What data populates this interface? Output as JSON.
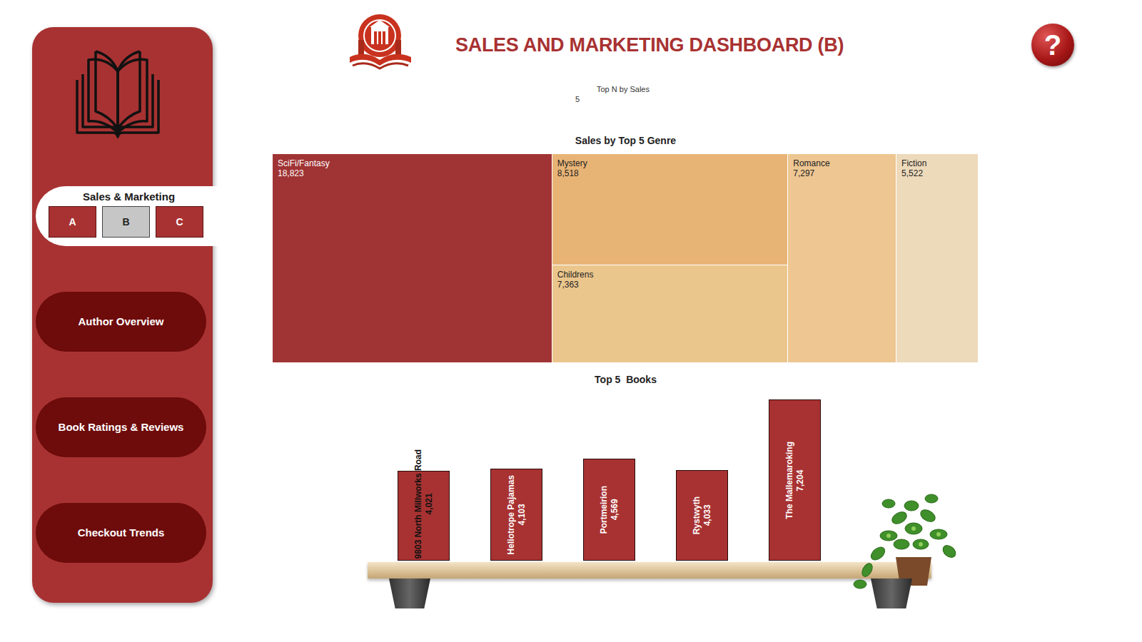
{
  "header": {
    "title": "SALES AND MARKETING DASHBOARD (B)",
    "help": "?"
  },
  "sidebar": {
    "section": "Sales & Marketing",
    "pages": [
      {
        "label": "A",
        "selected": false
      },
      {
        "label": "B",
        "selected": true
      },
      {
        "label": "C",
        "selected": false
      }
    ],
    "nav": [
      {
        "label": "Author Overview"
      },
      {
        "label": "Book Ratings & Reviews"
      },
      {
        "label": "Checkout Trends"
      }
    ]
  },
  "filter": {
    "label": "Top N by Sales",
    "value": "5"
  },
  "genre_chart": {
    "title": "Sales by Top 5 Genre",
    "items": [
      {
        "label": "SciFi/Fantasy",
        "value_text": "18,823",
        "value": 18823,
        "color": "#a03434"
      },
      {
        "label": "Mystery",
        "value_text": "8,518",
        "value": 8518,
        "color": "#e8b476"
      },
      {
        "label": "Childrens",
        "value_text": "7,363",
        "value": 7363,
        "color": "#ebc68c"
      },
      {
        "label": "Romance",
        "value_text": "7,297",
        "value": 7297,
        "color": "#edc692"
      },
      {
        "label": "Fiction",
        "value_text": "5,522",
        "value": 5522,
        "color": "#eddabb"
      }
    ]
  },
  "books_chart": {
    "title": "Top 5  Books",
    "items": [
      {
        "label": "9803 North Millworks Road",
        "value_text": "4,021",
        "value": 4021
      },
      {
        "label": "Heliotrope Pajamas",
        "value_text": "4,103",
        "value": 4103
      },
      {
        "label": "Portmeirion",
        "value_text": "4,569",
        "value": 4569
      },
      {
        "label": "Rystwyth",
        "value_text": "4,033",
        "value": 4033
      },
      {
        "label": "The Mallemaroking",
        "value_text": "7,204",
        "value": 7204
      }
    ]
  }
}
